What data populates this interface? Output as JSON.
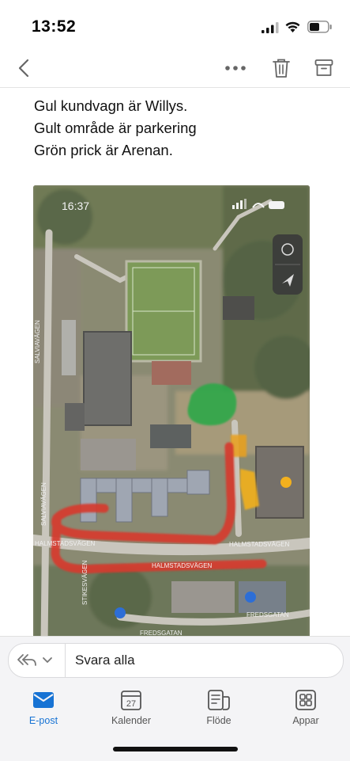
{
  "status_bar": {
    "time": "13:52"
  },
  "message": {
    "lines": [
      "Gul kundvagn är Willys.",
      "Gult område är parkering",
      "Grön prick är Arenan."
    ]
  },
  "map": {
    "inner_time": "16:37",
    "street_labels": [
      "SALVIAVÄGEN",
      "SALVIAVÄGEN",
      "HALMSTADSVÄGEN",
      "HALMSTADSVÄGEN",
      "STIKESVÄGEN",
      "FREDSGATAN",
      "FREDSGATAN",
      "HALMSTADSVÄGEN"
    ],
    "annotation_colors": {
      "red_route": "#d63a2f",
      "green_arena": "#2fa84a",
      "yellow_parking": "#f2b01e"
    }
  },
  "reply_bar": {
    "label": "Svara alla"
  },
  "tabs": [
    {
      "label": "E-post",
      "icon": "mail-icon",
      "active": true
    },
    {
      "label": "Kalender",
      "icon": "calendar-icon",
      "day": "27"
    },
    {
      "label": "Flöde",
      "icon": "feed-icon"
    },
    {
      "label": "Appar",
      "icon": "apps-icon"
    }
  ],
  "colors": {
    "accent": "#1773d4"
  }
}
